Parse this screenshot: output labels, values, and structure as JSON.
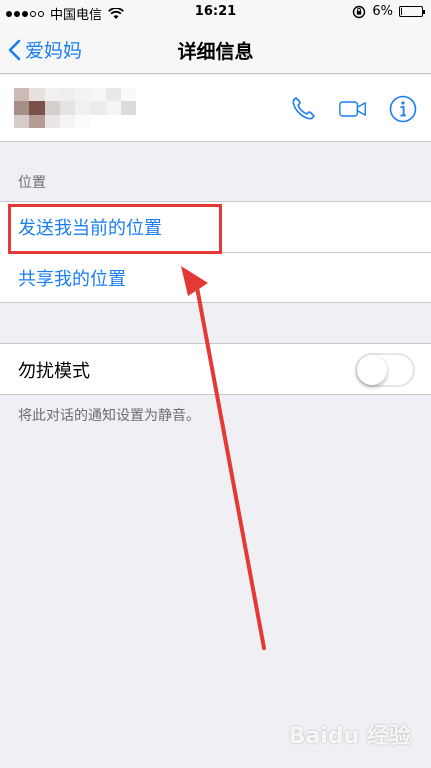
{
  "status_bar": {
    "carrier": "中国电信",
    "time": "16:21",
    "battery": "6%",
    "battery_level": 0.06
  },
  "nav": {
    "back_label": "爱妈妈",
    "title": "详细信息"
  },
  "contact": {
    "actions": [
      {
        "icon": "phone-icon"
      },
      {
        "icon": "video-icon"
      },
      {
        "icon": "info-icon"
      }
    ],
    "accent": "#1a7ef2"
  },
  "location_section": {
    "header": "位置",
    "items": [
      {
        "label": "发送我当前的位置"
      },
      {
        "label": "共享我的位置"
      }
    ]
  },
  "dnd": {
    "label": "勿扰模式",
    "enabled": false,
    "note": "将此对话的通知设置为静音。"
  },
  "annotation": {
    "highlight_color": "#e53935"
  },
  "watermark": "Baidu 经验"
}
